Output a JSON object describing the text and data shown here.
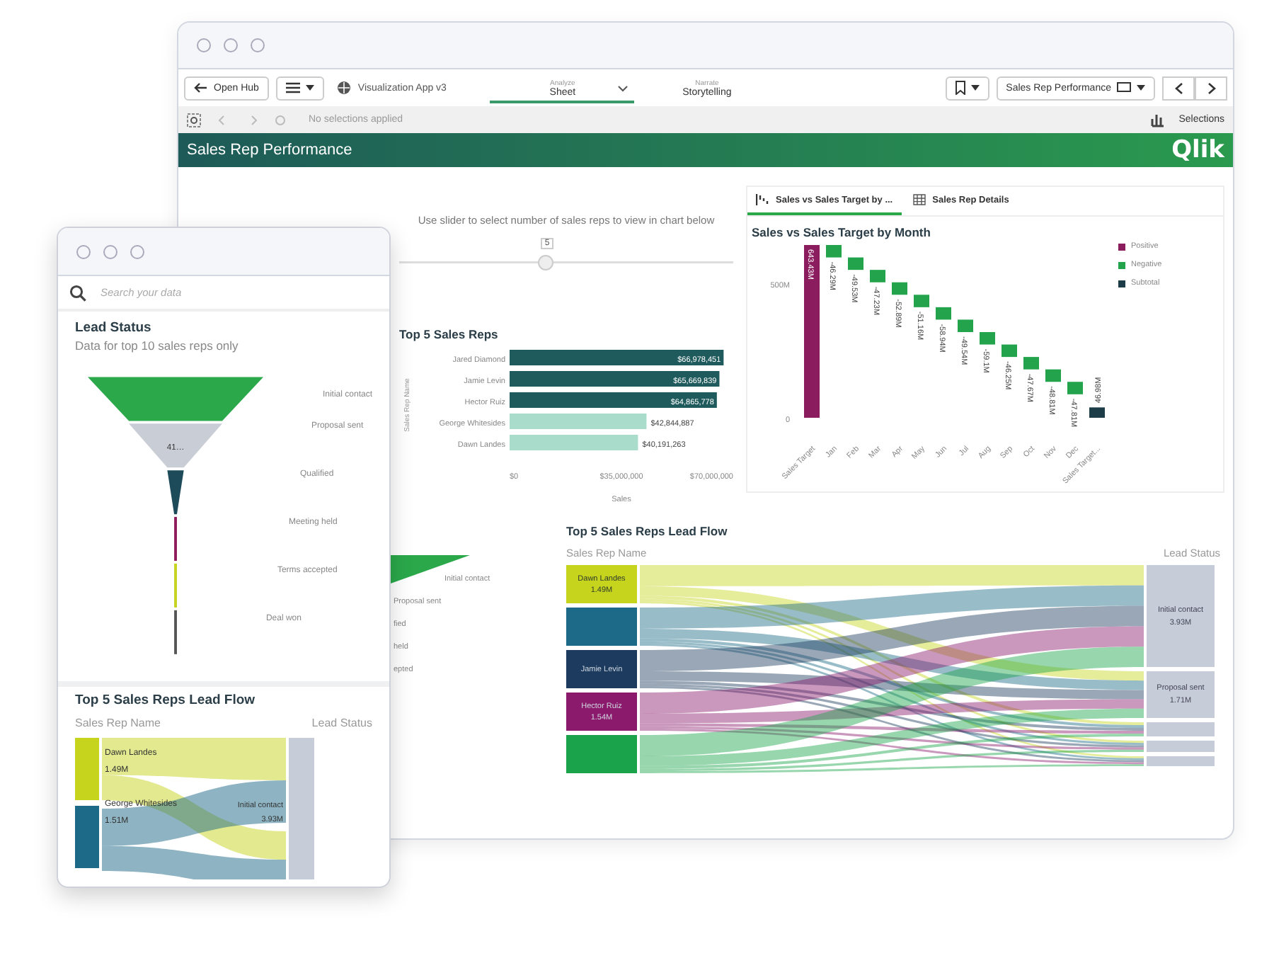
{
  "back_window": {
    "toolbar": {
      "open_hub": "Open Hub",
      "app_name": "Visualization App v3",
      "sheet_selector": "Sales Rep Performance",
      "tabs": [
        {
          "caption": "Analyze",
          "label": "Sheet",
          "selected": true
        },
        {
          "caption": "Narrate",
          "label": "Storytelling",
          "selected": false
        }
      ]
    },
    "selection_bar": {
      "status": "No selections applied",
      "selections_label": "Selections"
    },
    "banner": {
      "title": "Sales Rep Performance",
      "logo": "Qlik"
    },
    "slider": {
      "caption": "Use slider to select number of sales reps to view in chart below",
      "reading": "5",
      "level": 0.44
    },
    "bar_chart": {
      "title": "Top 5 Sales Reps",
      "chart_data": {
        "type": "bar",
        "orientation": "horizontal",
        "xlabel": "Sales",
        "ylabel": "Sales Rep Name",
        "categories": [
          "Jared Diamond",
          "Jamie Levin",
          "Hector Ruiz",
          "George Whitesides",
          "Dawn Landes"
        ],
        "series": [
          {
            "color": "#1f5a5c",
            "values": [
              66978451,
              65669839,
              64865778,
              null,
              null
            ]
          },
          {
            "color": "#a9dccb",
            "values": [
              null,
              null,
              null,
              42844887,
              40191263
            ]
          }
        ],
        "xlim": [
          0,
          70000000
        ],
        "xticks": [
          {
            "value": 0,
            "label": "$0"
          },
          {
            "value": 35000000,
            "label": "$35,000,000"
          },
          {
            "value": 70000000,
            "label": "$70,000,000"
          }
        ],
        "value_labels": [
          "$66,978,451",
          "$65,669,839",
          "$64,865,778",
          "$42,844,887",
          "$40,191,263"
        ]
      }
    },
    "waterfall": {
      "tabs": [
        {
          "label": "Sales vs Sales Target by ...",
          "selected": true
        },
        {
          "label": "Sales Rep Details",
          "selected": false
        }
      ],
      "title": "Sales vs Sales Target by Month",
      "legend": [
        {
          "kind": "positive",
          "label": "Positive",
          "color": "#8b1d5e"
        },
        {
          "kind": "negative",
          "label": "Negative",
          "color": "#22a34c"
        },
        {
          "kind": "subtotal",
          "label": "Subtotal",
          "color": "#1c3d48"
        }
      ],
      "y_ticks": [
        "500M",
        "0"
      ],
      "bars": [
        {
          "kind": "positive",
          "category": "Sales Target",
          "value_label": "643.43M"
        },
        {
          "kind": "negative",
          "category": "Jan",
          "value_label": "-46.29M"
        },
        {
          "kind": "negative",
          "category": "Feb",
          "value_label": "-49.53M"
        },
        {
          "kind": "negative",
          "category": "Mar",
          "value_label": "-47.23M"
        },
        {
          "kind": "negative",
          "category": "Apr",
          "value_label": "-52.89M"
        },
        {
          "kind": "negative",
          "category": "May",
          "value_label": "-51.16M"
        },
        {
          "kind": "negative",
          "category": "Jun",
          "value_label": "-58.94M"
        },
        {
          "kind": "negative",
          "category": "Jul",
          "value_label": "-49.54M"
        },
        {
          "kind": "negative",
          "category": "Aug",
          "value_label": "-59.1M"
        },
        {
          "kind": "negative",
          "category": "Sep",
          "value_label": "-46.25M"
        },
        {
          "kind": "negative",
          "category": "Oct",
          "value_label": "-47.67M"
        },
        {
          "kind": "negative",
          "category": "Nov",
          "value_label": "-48.81M"
        },
        {
          "kind": "negative",
          "category": "Dec",
          "value_label": "-47.81M"
        },
        {
          "kind": "subtotal",
          "category": "Sales Target...",
          "value_label": "46.98M"
        }
      ]
    },
    "partial_funnel": {
      "labels": [
        "Initial contact",
        "Proposal sent",
        "fied",
        "held",
        "epted"
      ]
    },
    "lead_flow": {
      "title": "Top 5 Sales Reps Lead Flow",
      "left_heading": "Sales Rep Name",
      "right_heading": "Lead Status",
      "sources": [
        {
          "name": "Dawn Landes",
          "value": "1.49M",
          "color": "#c6d41e"
        },
        {
          "color": "#1d6a88"
        },
        {
          "name": "Jamie Levin",
          "color": "#1d3b5e"
        },
        {
          "name": "Hector Ruiz",
          "value": "1.54M",
          "color": "#8c1a6c"
        },
        {
          "color": "#1aa34a"
        }
      ],
      "targets": [
        {
          "name": "Initial contact",
          "value": "3.93M"
        },
        {
          "name": "Proposal sent",
          "value": "1.71M"
        }
      ]
    }
  },
  "front_window": {
    "search": {
      "placeholder": "Search your data"
    },
    "funnel": {
      "title": "Lead Status",
      "subtitle": "Data for top 10 sales reps only",
      "stages": [
        {
          "label": "Initial contact",
          "color": "#2aa84a"
        },
        {
          "label": "Proposal sent",
          "value": "41…",
          "color": "#c9cdd5"
        },
        {
          "label": "Qualified",
          "color": "#1e4b5a"
        },
        {
          "label": "Meeting held",
          "color": "#8e1a5c"
        },
        {
          "label": "Terms accepted",
          "color": "#c6d41e"
        },
        {
          "label": "Deal won",
          "color": "#555555"
        }
      ]
    },
    "lead_flow": {
      "title": "Top 5 Sales Reps Lead Flow",
      "left_heading": "Sales Rep Name",
      "right_heading": "Lead Status",
      "sources": [
        {
          "name": "Dawn Landes",
          "value": "1.49M",
          "color": "#c6d41e"
        },
        {
          "name": "George Whitesides",
          "value": "1.51M",
          "color": "#1d6a88"
        }
      ],
      "targets": [
        {
          "name": "Initial contact",
          "value": "3.93M"
        }
      ]
    }
  }
}
